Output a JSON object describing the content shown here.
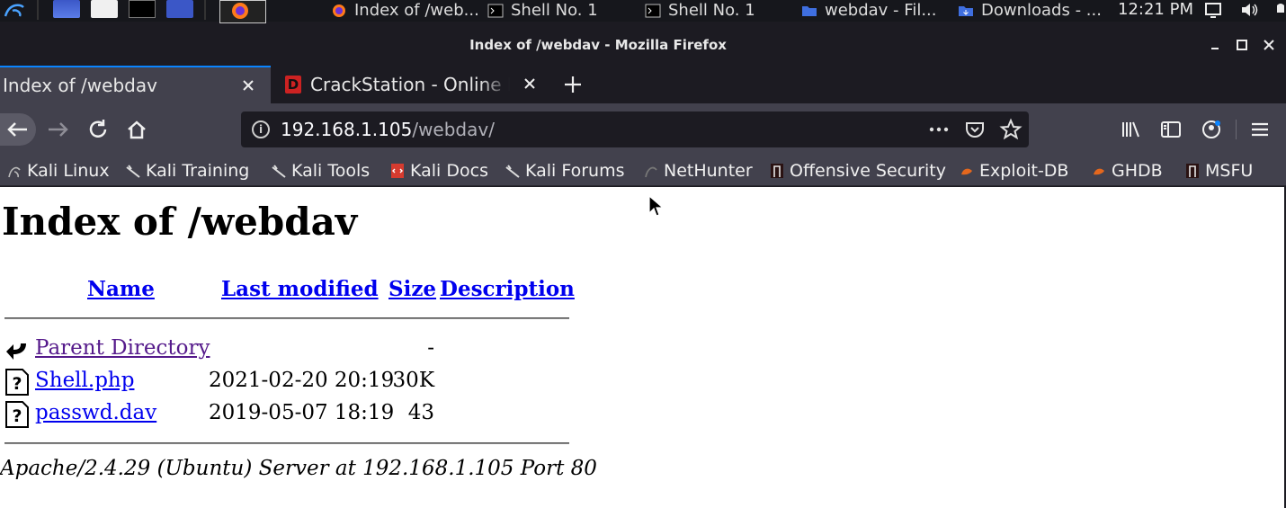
{
  "taskbar": {
    "tasks": [
      {
        "label": "Index of /web..."
      },
      {
        "label": "Shell No. 1"
      },
      {
        "label": "Shell No. 1"
      },
      {
        "label": "webdav - Fil..."
      },
      {
        "label": "Downloads - ..."
      }
    ],
    "clock": "12:21 PM"
  },
  "window": {
    "title": "Index of /webdav - Mozilla Firefox"
  },
  "tabs": [
    {
      "label": "Index of /webdav",
      "active": true
    },
    {
      "label": "CrackStation - Online Pa",
      "favicon": "D",
      "active": false
    }
  ],
  "urlbar": {
    "host": "192.168.1.105",
    "path": "/webdav/"
  },
  "bookmarks": [
    {
      "label": "Kali Linux",
      "icon": "kali-dragon-icon"
    },
    {
      "label": "Kali Training",
      "icon": "kali-dragon-icon"
    },
    {
      "label": "Kali Tools",
      "icon": "kali-dragon-icon"
    },
    {
      "label": "Kali Docs",
      "icon": "kali-docs-icon"
    },
    {
      "label": "Kali Forums",
      "icon": "kali-dragon-icon"
    },
    {
      "label": "NetHunter",
      "icon": "nethunter-icon"
    },
    {
      "label": "Offensive Security",
      "icon": "offsec-icon"
    },
    {
      "label": "Exploit-DB",
      "icon": "exploitdb-icon"
    },
    {
      "label": "GHDB",
      "icon": "exploitdb-icon"
    },
    {
      "label": "MSFU",
      "icon": "offsec-icon"
    }
  ],
  "page": {
    "heading": "Index of /webdav",
    "columns": {
      "name": "Name",
      "last_modified": "Last modified",
      "size": "Size",
      "description": "Description"
    },
    "rows": [
      {
        "name": "Parent Directory",
        "date": "",
        "size": "-",
        "icon": "back-arrow-icon",
        "visited": true
      },
      {
        "name": "Shell.php",
        "date": "2021-02-20 20:19",
        "size": "30K",
        "icon": "unknown-file-icon",
        "visited": false
      },
      {
        "name": "passwd.dav",
        "date": "2019-05-07 18:19",
        "size": "43",
        "icon": "unknown-file-icon",
        "visited": false
      }
    ],
    "address": "Apache/2.4.29 (Ubuntu) Server at 192.168.1.105 Port 80"
  },
  "colors": {
    "link": "#0000ee",
    "visited": "#551a8b",
    "tab_accent": "#0a84ff",
    "toolbar": "#42414d",
    "chrome_dark": "#1c1b22"
  }
}
